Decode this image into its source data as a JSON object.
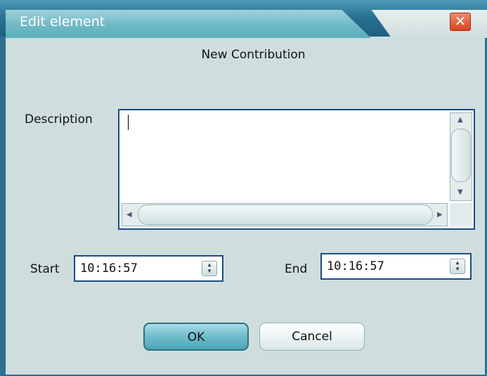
{
  "window": {
    "title": "Edit element",
    "close_symbol": "✕"
  },
  "heading": "New Contribution",
  "description": {
    "label": "Description",
    "value": ""
  },
  "start": {
    "label": "Start",
    "value": "10:16:57"
  },
  "end": {
    "label": "End",
    "value": "10:16:57"
  },
  "buttons": {
    "ok": "OK",
    "cancel": "Cancel"
  }
}
